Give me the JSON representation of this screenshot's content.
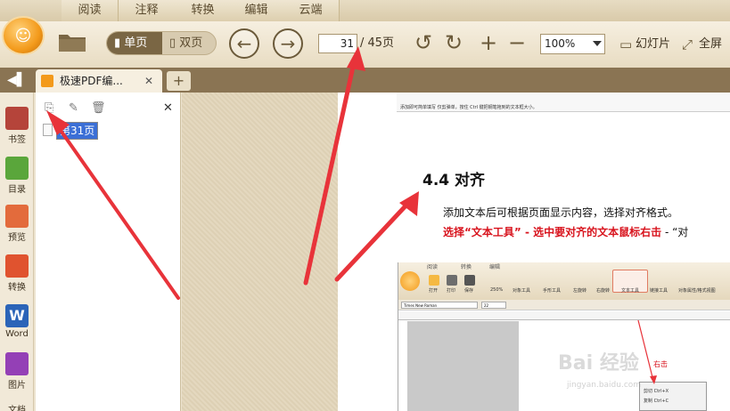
{
  "menu_tabs": [
    "阅读",
    "注释",
    "转换",
    "编辑",
    "云端"
  ],
  "toolbar": {
    "view_single": "单页",
    "view_double": "双页",
    "current_page": "31",
    "total_pages": "/ 45页",
    "zoom": "100%",
    "slideshow": "幻灯片",
    "fullscreen": "全屏"
  },
  "tabs": {
    "doc_title": "极速PDF编...",
    "close": "✕",
    "add": "+"
  },
  "leftbar": [
    "书签",
    "目录",
    "预览",
    "转换",
    "Word",
    "图片",
    "文档"
  ],
  "bookmark_panel": {
    "close": "✕",
    "item_label": "第31页"
  },
  "document": {
    "top_note": "添加即可简单填写 仅剪弹单，按住 Ctrl 键把钢笔拖到的文本框大小。",
    "heading": "4.4 对齐",
    "para1": "添加文本后可根据页面显示内容，选择对齐格式。",
    "para2_red": "选择“文本工具” - 选中要对齐的文本鼠标右击",
    "para2_rest": " - “对",
    "embedded": {
      "tabs": [
        "阅读",
        "转换",
        "编辑"
      ],
      "tools": [
        "打开",
        "打印",
        "保存",
        "250%",
        "对象工具",
        "手形工具",
        "左旋转",
        "右旋转",
        "文本工具",
        "链接工具",
        "对象属性/格式视图"
      ],
      "font": "Times New Roman",
      "size": "22",
      "red_label": "右击",
      "menu_items": [
        "剪切   Ctrl+X",
        "复制   Ctrl+C"
      ]
    },
    "watermark": "Bai 经验",
    "watermark_url": "jingyan.baidu.com"
  },
  "colors": {
    "accent_orange": "#f39a1b",
    "arrow_red": "#e8333a",
    "tabbar_brown": "#8a7453"
  }
}
